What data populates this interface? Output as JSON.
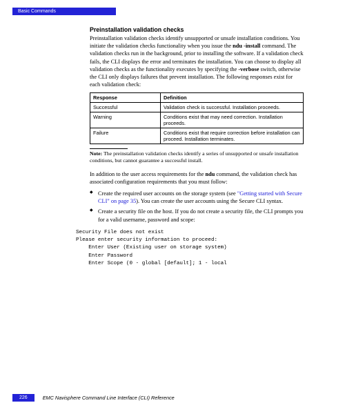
{
  "header": {
    "tab": "Basic Commands"
  },
  "section": {
    "title": "Preinstallation validation checks",
    "para1_a": "Preinstallation validation checks identify unsupported or unsafe installation conditions. You initiate the validation checks functionality when you issue the ",
    "para1_cmd1": "ndu -install",
    "para1_b": " command. The validation checks run in the background, prior to installing the software. If a validation check fails, the CLI displays the error and terminates the installation. You can choose to display all validation checks as the functionality executes by specifying the ",
    "para1_cmd2": "-verbose",
    "para1_c": " switch, otherwise the CLI only displays failures that prevent installation. The following responses exist for each validation check:"
  },
  "table": {
    "headers": {
      "response": "Response",
      "definition": "Definition"
    },
    "rows": [
      {
        "response": "Successful",
        "definition": "Validation check is successful. Installation proceeds."
      },
      {
        "response": "Warning",
        "definition": "Conditions exist that may need correction. Installation proceeds."
      },
      {
        "response": "Failure",
        "definition": "Conditions exist that require correction before installation can proceed. Installation terminates."
      }
    ]
  },
  "note": {
    "label": "Note:",
    "text": " The preinstallation validation checks identify a series of unsupported or unsafe installation conditions, but cannot guarantee a successful install."
  },
  "para2_a": "In addition to the user access requirements for the ",
  "para2_cmd": "ndu",
  "para2_b": " command, the validation check has associated configuration requirements that you must follow:",
  "bullets": [
    {
      "a": "Create the required user accounts on the storage system (see ",
      "link": "\"Getting started with Secure CLI\" on page 35",
      "b": "). You can create the user accounts using the Secure CLI syntax."
    },
    {
      "a": "Create a security file on the host. If you do not create a security file, the CLI prompts you for a valid username, password and scope:",
      "link": "",
      "b": ""
    }
  ],
  "code": "Security File does not exist\nPlease enter security information to proceed:\n    Enter User (Existing user on storage system)\n    Enter Password\n    Enter Scope (0 - global [default]; 1 - local",
  "footer": {
    "page": "226",
    "text": "EMC Navisphere Command Line Interface (CLI) Reference"
  }
}
